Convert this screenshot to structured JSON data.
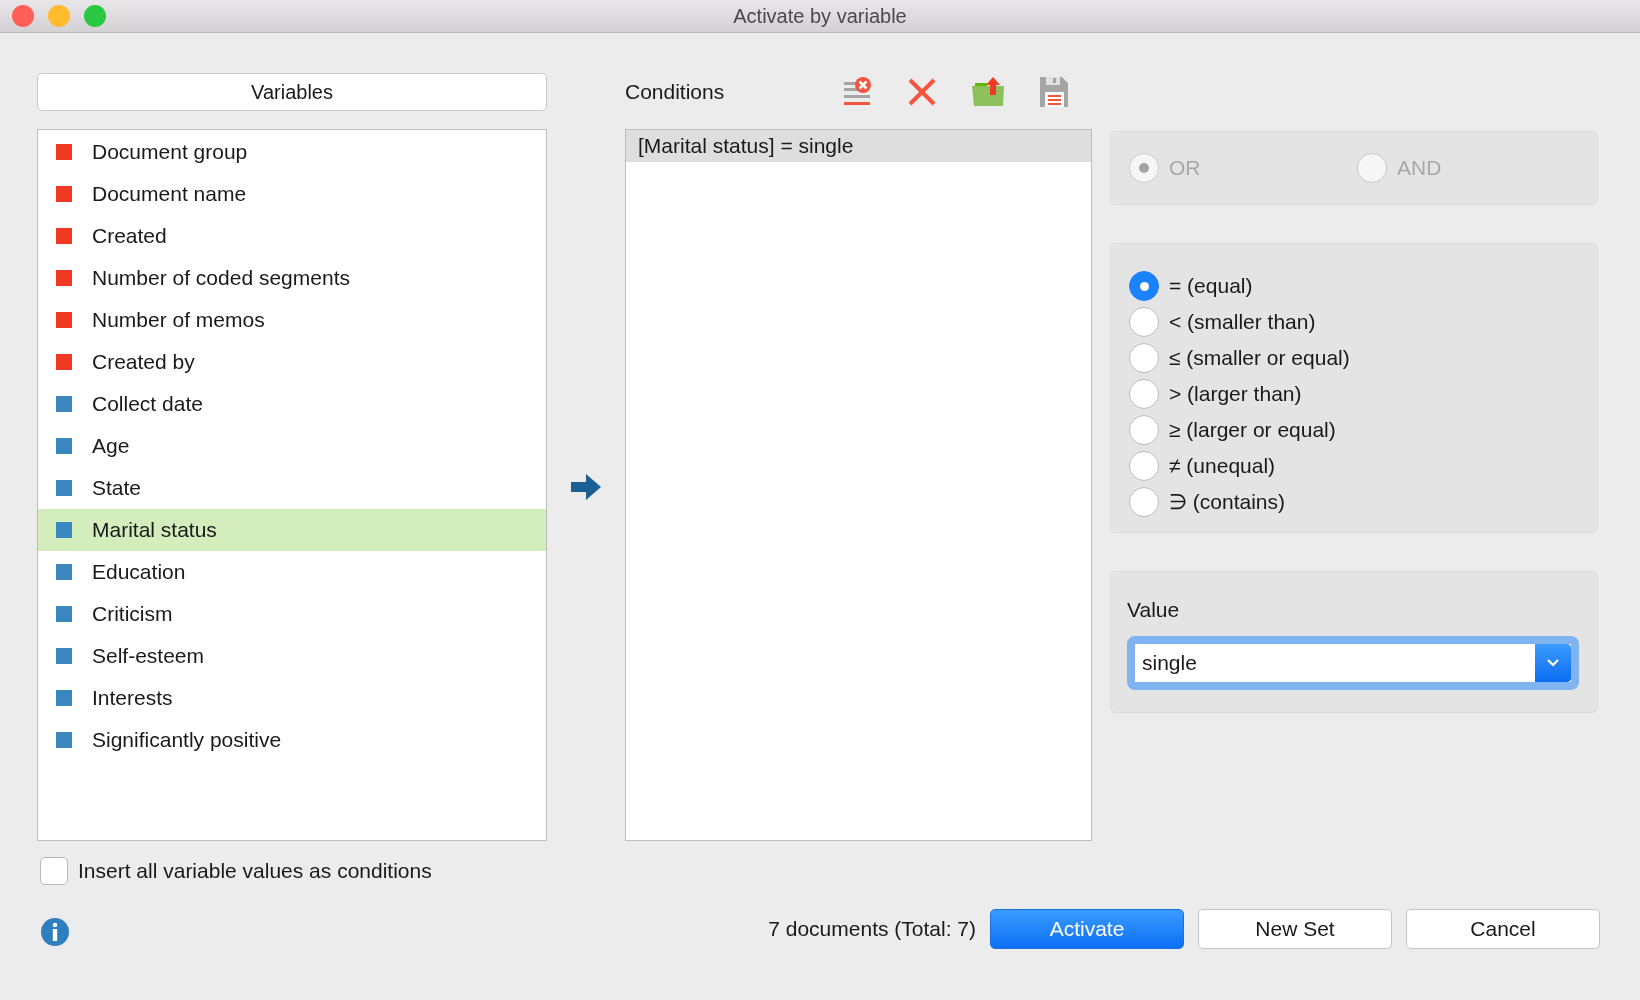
{
  "window": {
    "title": "Activate by variable"
  },
  "variables": {
    "header": "Variables",
    "items": [
      {
        "name": "Document group",
        "color": "#f03a24",
        "selected": false
      },
      {
        "name": "Document name",
        "color": "#f03a24",
        "selected": false
      },
      {
        "name": "Created",
        "color": "#f03a24",
        "selected": false
      },
      {
        "name": "Number of coded segments",
        "color": "#f03a24",
        "selected": false
      },
      {
        "name": "Number of memos",
        "color": "#f03a24",
        "selected": false
      },
      {
        "name": "Created by",
        "color": "#f03a24",
        "selected": false
      },
      {
        "name": "Collect date",
        "color": "#3a87c0",
        "selected": false
      },
      {
        "name": "Age",
        "color": "#3a87c0",
        "selected": false
      },
      {
        "name": "State",
        "color": "#3a87c0",
        "selected": false
      },
      {
        "name": "Marital status",
        "color": "#3a87c0",
        "selected": true
      },
      {
        "name": "Education",
        "color": "#3a87c0",
        "selected": false
      },
      {
        "name": "Criticism",
        "color": "#3a87c0",
        "selected": false
      },
      {
        "name": "Self-esteem",
        "color": "#3a87c0",
        "selected": false
      },
      {
        "name": "Interests",
        "color": "#3a87c0",
        "selected": false
      },
      {
        "name": "Significantly positive",
        "color": "#3a87c0",
        "selected": false
      }
    ]
  },
  "conditions": {
    "title": "Conditions",
    "items": [
      {
        "text": "[Marital status] = single",
        "selected": true
      }
    ]
  },
  "logic": {
    "disabled": true,
    "options": [
      {
        "label": "OR",
        "selected": true
      },
      {
        "label": "AND",
        "selected": false
      }
    ]
  },
  "operators": [
    {
      "label": "= (equal)",
      "selected": true
    },
    {
      "label": "< (smaller than)",
      "selected": false
    },
    {
      "label": "≤ (smaller or equal)",
      "selected": false
    },
    {
      "label": "> (larger than)",
      "selected": false
    },
    {
      "label": "≥ (larger or equal)",
      "selected": false
    },
    {
      "label": "≠ (unequal)",
      "selected": false
    },
    {
      "label": "∋ (contains)",
      "selected": false
    }
  ],
  "value": {
    "label": "Value",
    "value": "single"
  },
  "insert_all": {
    "label": "Insert all variable values as conditions",
    "checked": false
  },
  "status": "7 documents (Total: 7)",
  "buttons": [
    {
      "label": "Activate",
      "kind": "primary"
    },
    {
      "label": "New Set",
      "kind": "normal"
    },
    {
      "label": "Cancel",
      "kind": "normal"
    }
  ]
}
